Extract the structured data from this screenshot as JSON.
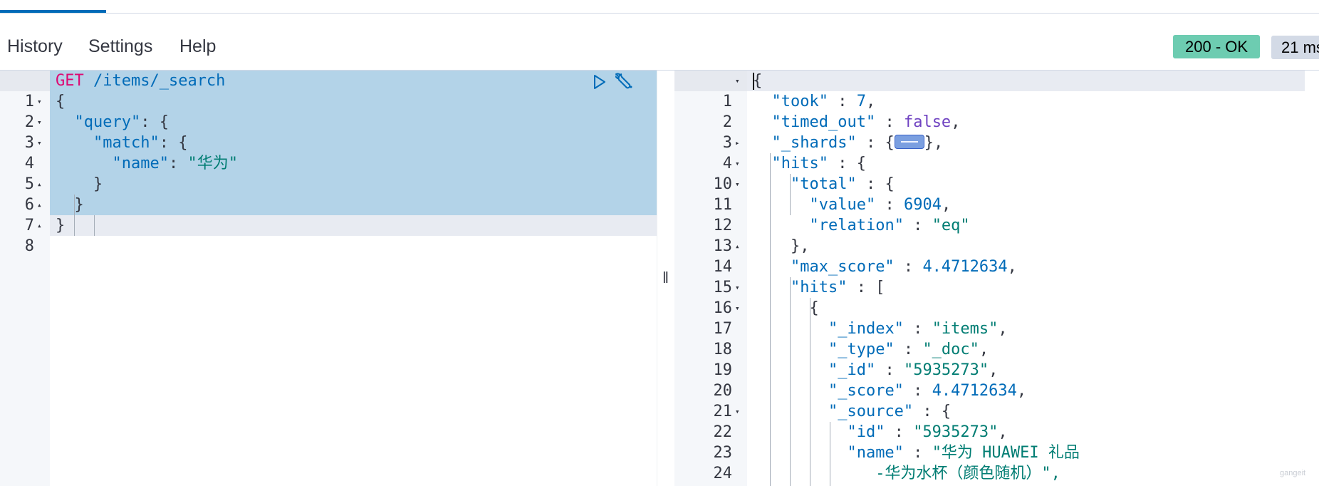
{
  "menu": {
    "history": "History",
    "settings": "Settings",
    "help": "Help"
  },
  "status": {
    "code": "200 - OK",
    "time": "21 ms"
  },
  "request": {
    "method": "GET",
    "path": " /items/_search",
    "lines": [
      {
        "num": "1",
        "fold": ""
      },
      {
        "num": "2",
        "fold": "▾"
      },
      {
        "num": "3",
        "fold": "▾"
      },
      {
        "num": "4",
        "fold": "▾"
      },
      {
        "num": "5",
        "fold": ""
      },
      {
        "num": "6",
        "fold": "▴"
      },
      {
        "num": "7",
        "fold": "▴"
      },
      {
        "num": "8",
        "fold": "▴"
      }
    ],
    "code": {
      "l2": "{",
      "l3_key": "\"query\"",
      "l3_rest": ": {",
      "l4_key": "\"match\"",
      "l4_rest": ": {",
      "l5_key": "\"name\"",
      "l5_colon": ": ",
      "l5_val": "\"华为\"",
      "l6": "}",
      "l7": "}",
      "l8": "}"
    }
  },
  "response": {
    "lines": [
      {
        "num": "1",
        "fold": "▾"
      },
      {
        "num": "2",
        "fold": ""
      },
      {
        "num": "3",
        "fold": ""
      },
      {
        "num": "4",
        "fold": "▸"
      },
      {
        "num": "10",
        "fold": "▾"
      },
      {
        "num": "11",
        "fold": "▾"
      },
      {
        "num": "12",
        "fold": ""
      },
      {
        "num": "13",
        "fold": ""
      },
      {
        "num": "14",
        "fold": "▴"
      },
      {
        "num": "15",
        "fold": ""
      },
      {
        "num": "16",
        "fold": "▾"
      },
      {
        "num": "17",
        "fold": "▾"
      },
      {
        "num": "18",
        "fold": ""
      },
      {
        "num": "19",
        "fold": ""
      },
      {
        "num": "20",
        "fold": ""
      },
      {
        "num": "21",
        "fold": ""
      },
      {
        "num": "22",
        "fold": "▾"
      },
      {
        "num": "23",
        "fold": ""
      },
      {
        "num": "24",
        "fold": ""
      }
    ],
    "code": {
      "r1": "{",
      "took_key": "\"took\"",
      "took_sep": " : ",
      "took_val": "7",
      "comma": ",",
      "timed_key": "\"timed_out\"",
      "timed_val": "false",
      "shards_key": "\"_shards\"",
      "shards_open": " : {",
      "shards_close": "},",
      "hits_key": "\"hits\"",
      "obj_open": " : {",
      "total_key": "\"total\"",
      "value_key": "\"value\"",
      "value_val": "6904",
      "relation_key": "\"relation\"",
      "relation_val": "\"eq\"",
      "close_comma": "},",
      "max_score_key": "\"max_score\"",
      "max_score_val": "4.4712634",
      "hits2_key": "\"hits\"",
      "arr_open": " : [",
      "brace": "{",
      "index_key": "\"_index\"",
      "index_val": "\"items\"",
      "type_key": "\"_type\"",
      "type_val": "\"_doc\"",
      "id_key": "\"_id\"",
      "id_val": "\"5935273\"",
      "score_key": "\"_score\"",
      "score_val": "4.4712634",
      "source_key": "\"_source\"",
      "sid_key": "\"id\"",
      "sid_val": "\"5935273\"",
      "name_key": "\"name\"",
      "name_val_1": "\"华为 HUAWEI 礼品",
      "name_val_2": "-华为水杯（颜色随机）\",",
      "sep": " : "
    }
  },
  "watermark": "gangeit"
}
